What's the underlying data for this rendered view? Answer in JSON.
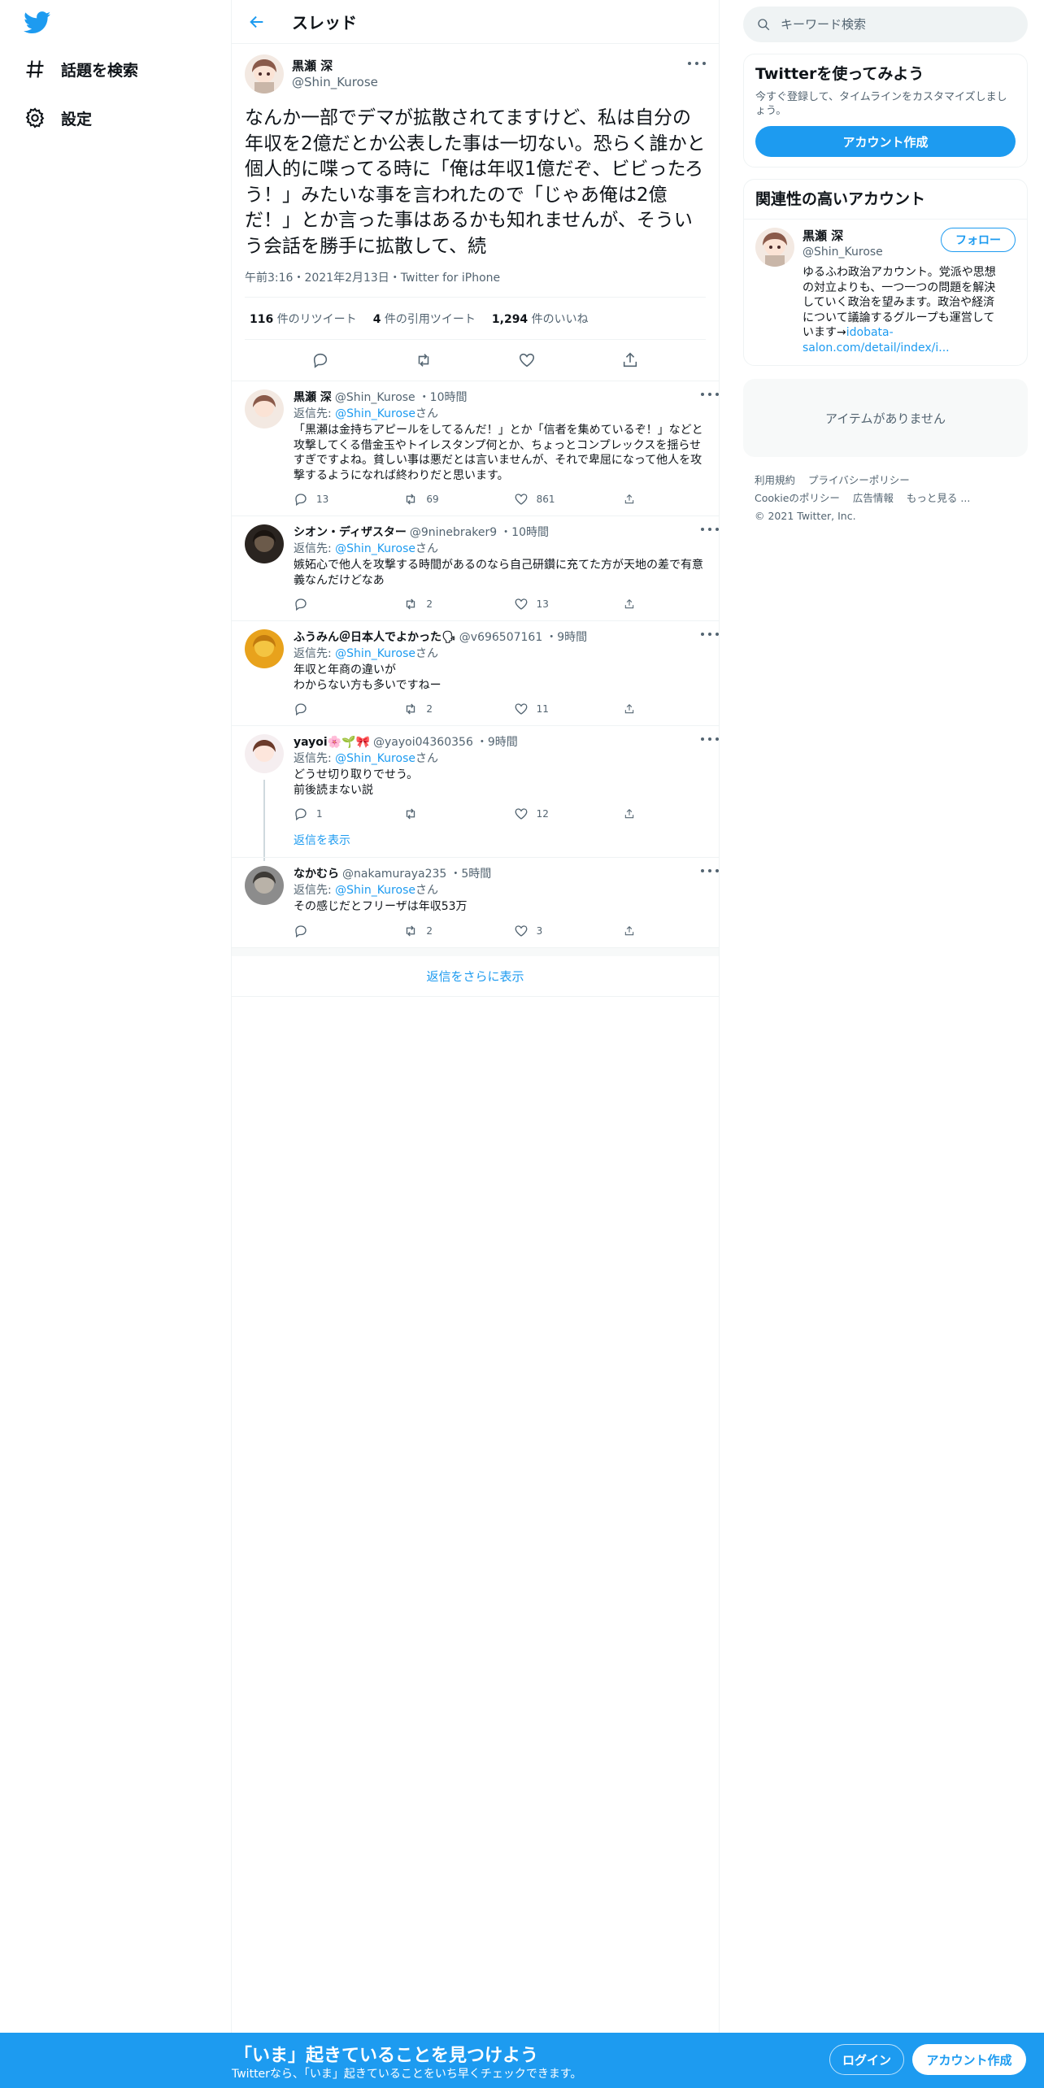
{
  "colors": {
    "accent": "#1d9bf0",
    "text": "#0f1419",
    "muted": "#536471",
    "border": "#eff3f4"
  },
  "nav": {
    "logo_icon": "twitter-bird-icon",
    "explore_label": "話題を検索",
    "settings_label": "設定"
  },
  "header": {
    "title": "スレッド"
  },
  "focal": {
    "name": "黒瀬 深",
    "handle": "@Shin_Kurose",
    "text": "なんか一部でデマが拡散されてますけど、私は自分の年収を2億だとか公表した事は一切ない。恐らく誰かと個人的に喋ってる時に「俺は年収1億だぞ、ビビったろう！」みたいな事を言われたので「じゃあ俺は2億だ！」とか言った事はあるかも知れませんが、そういう会話を勝手に拡散して、続",
    "meta": "午前3:16・2021年2月13日・Twitter for iPhone",
    "retweets": "116",
    "retweets_label": "件のリツイート",
    "quotes": "4",
    "quotes_label": "件の引用ツイート",
    "likes": "1,294",
    "likes_label": "件のいいね"
  },
  "replies": [
    {
      "name": "黒瀬 深",
      "handle": "@Shin_Kurose",
      "time": "・10時間",
      "reply_to_prefix": "返信先: ",
      "reply_to_handle": "@Shin_Kurose",
      "reply_to_suffix": "さん",
      "text": "「黒瀬は金持ちアピールをしてるんだ！」とか「信者を集めているぞ！」などと攻撃してくる借金玉やトイレスタンプ何とか、ちょっとコンプレックスを揺らせすぎですよね。貧しい事は悪だとは言いませんが、それで卑屈になって他人を攻撃するようになれば終わりだと思います。",
      "replies": "13",
      "retweets": "69",
      "likes": "861"
    },
    {
      "name": "シオン・ディザスター",
      "handle": "@9ninebraker9",
      "time": "・10時間",
      "reply_to_prefix": "返信先: ",
      "reply_to_handle": "@Shin_Kurose",
      "reply_to_suffix": "さん",
      "text": "嫉妬心で他人を攻撃する時間があるのなら自己研鑽に充てた方が天地の差で有意義なんだけどなあ",
      "replies": "",
      "retweets": "2",
      "likes": "13"
    },
    {
      "name": "ふうみん＠日本人でよかった🗣",
      "handle": "@v696507161",
      "time": "・9時間",
      "reply_to_prefix": "返信先: ",
      "reply_to_handle": "@Shin_Kurose",
      "reply_to_suffix": "さん",
      "text": "年収と年商の違いが\nわからない方も多いですねー",
      "replies": "",
      "retweets": "2",
      "likes": "11"
    },
    {
      "name": "yayoi🌸🌱🎀",
      "handle": "@yayoi04360356",
      "time": "・9時間",
      "reply_to_prefix": "返信先: ",
      "reply_to_handle": "@Shin_Kurose",
      "reply_to_suffix": "さん",
      "text": "どうせ切り取りでせう。\n前後読まない説",
      "replies": "1",
      "retweets": "",
      "likes": "12",
      "show_replies": "返信を表示"
    },
    {
      "name": "なかむら",
      "handle": "@nakamuraya235",
      "time": "・5時間",
      "reply_to_prefix": "返信先: ",
      "reply_to_handle": "@Shin_Kurose",
      "reply_to_suffix": "さん",
      "text": "その感じだとフリーザは年収53万",
      "replies": "",
      "retweets": "2",
      "likes": "3"
    }
  ],
  "show_more": "返信をさらに表示",
  "right": {
    "search_placeholder": "キーワード検索",
    "signup_title": "Twitterを使ってみよう",
    "signup_sub": "今すぐ登録して、タイムラインをカスタマイズしましょう。",
    "signup_button": "アカウント作成",
    "related_title": "関連性の高いアカウント",
    "related_name": "黒瀬 深",
    "related_handle": "@Shin_Kurose",
    "follow_button": "フォロー",
    "related_bio": "ゆるふわ政治アカウント。党派や思想の対立よりも、一つ一つの問題を解決していく政治を望みます。政治や経済について議論するグループも運営しています→",
    "related_link": "idobata-salon.com/detail/index/i...",
    "trends_empty": "アイテムがありません",
    "footer": [
      "利用規約",
      "プライバシーポリシー",
      "Cookieのポリシー",
      "広告情報",
      "もっと見る ...",
      "© 2021 Twitter, Inc."
    ]
  },
  "bottom": {
    "title": "「いま」起きていることを見つけよう",
    "sub": "Twitterなら、「いま」起きていることをいち早くチェックできます。",
    "login": "ログイン",
    "register": "アカウント作成"
  }
}
